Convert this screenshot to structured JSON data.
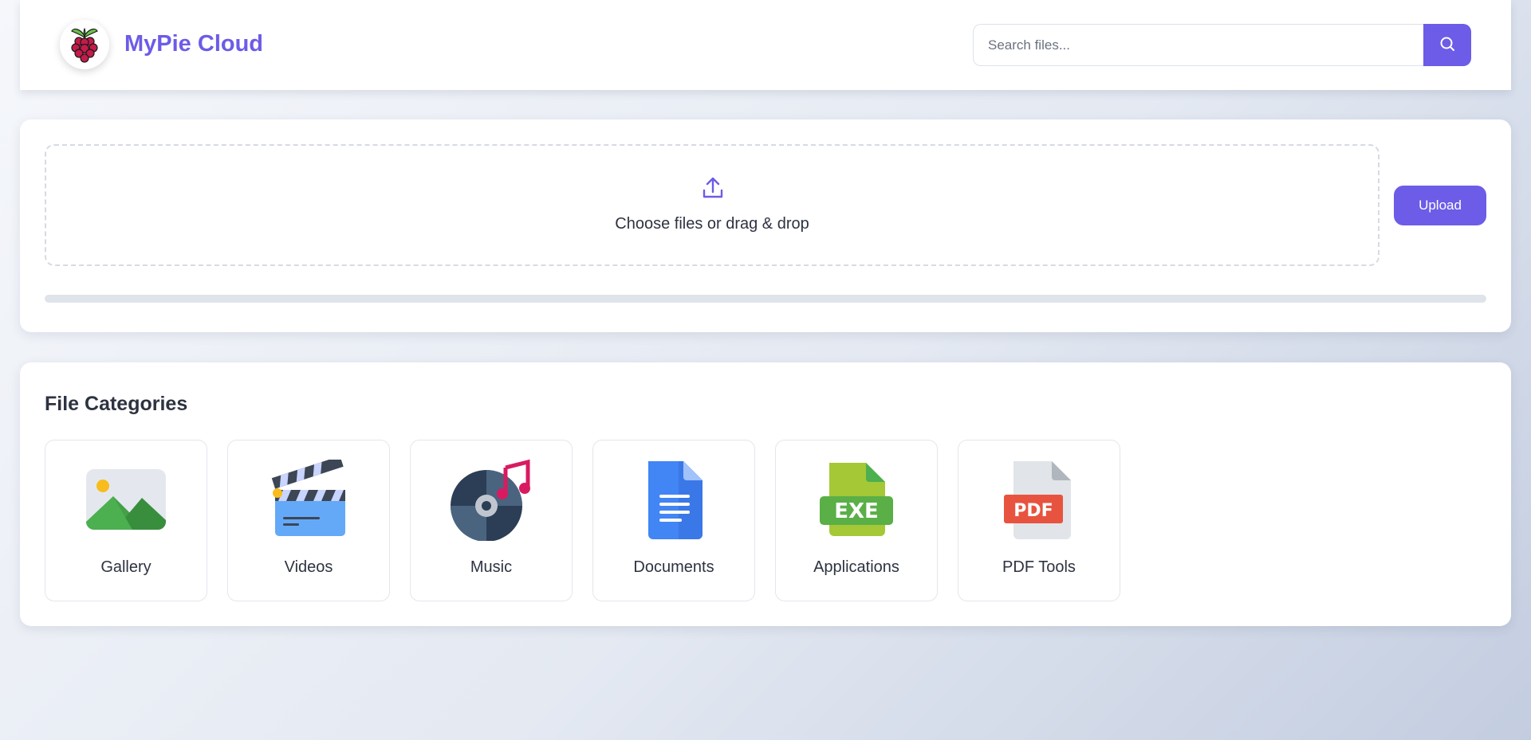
{
  "header": {
    "brand": "MyPie Cloud",
    "logo_icon": "raspberry-icon",
    "search_placeholder": "Search files...",
    "search_icon": "search-icon"
  },
  "upload": {
    "icon": "upload-icon",
    "drop_text": "Choose files or drag & drop",
    "button_label": "Upload",
    "progress_fraction": 0
  },
  "categories": {
    "title": "File Categories",
    "items": [
      {
        "label": "Gallery",
        "icon": "image-icon"
      },
      {
        "label": "Videos",
        "icon": "clapperboard-icon"
      },
      {
        "label": "Music",
        "icon": "music-disc-icon"
      },
      {
        "label": "Documents",
        "icon": "document-icon"
      },
      {
        "label": "Applications",
        "icon": "exe-file-icon"
      },
      {
        "label": "PDF Tools",
        "icon": "pdf-file-icon"
      }
    ]
  },
  "colors": {
    "accent": "#6c5ce7",
    "text": "#2d3340",
    "border": "#e3e6ec"
  }
}
